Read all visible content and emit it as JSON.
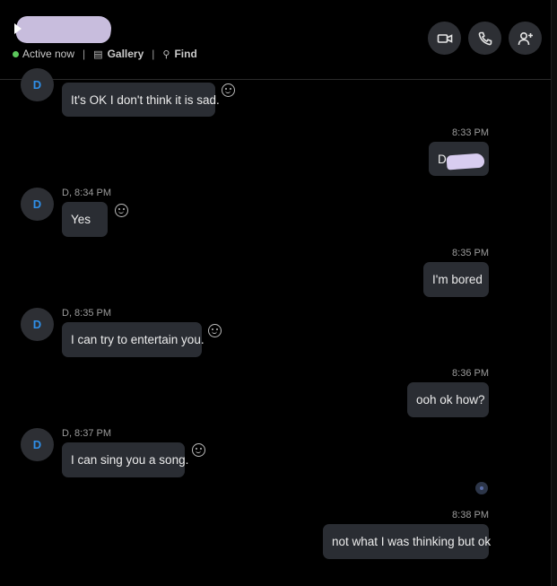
{
  "header": {
    "status_text": "Active now",
    "gallery_label": "Gallery",
    "find_label": "Find",
    "separator": "|"
  },
  "icons": {
    "video": "video-camera-icon",
    "call": "phone-icon",
    "add_people": "add-person-icon",
    "gallery": "gallery-icon",
    "find": "magnifier-icon",
    "reaction": "smiley-icon"
  },
  "colors": {
    "background": "#000000",
    "bubble": "#2a2d33",
    "presence": "#5cc85c",
    "avatar_text": "#2f8fe8"
  },
  "contact": {
    "avatar_initial": "D"
  },
  "messages": [
    {
      "side": "in",
      "text": "It's OK I don't think it is sad.",
      "meta": ""
    },
    {
      "side": "out",
      "text": "D",
      "meta": "8:33 PM"
    },
    {
      "side": "in",
      "text": "Yes",
      "meta": "D, 8:34 PM"
    },
    {
      "side": "out",
      "text": "I'm bored",
      "meta": "8:35 PM"
    },
    {
      "side": "in",
      "text": "I can try to entertain you.",
      "meta": "D, 8:35 PM"
    },
    {
      "side": "out",
      "text": "ooh ok how?",
      "meta": "8:36 PM"
    },
    {
      "side": "in",
      "text": "I can sing you a song.",
      "meta": "D, 8:37 PM"
    },
    {
      "side": "out",
      "text": "not what I was thinking but ok",
      "meta": "8:38 PM"
    }
  ]
}
